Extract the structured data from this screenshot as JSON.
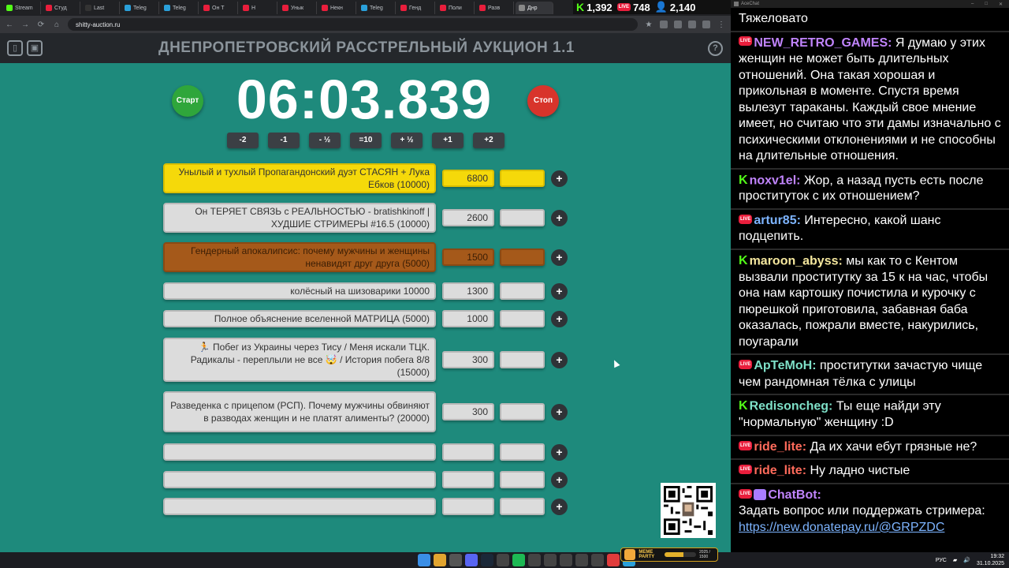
{
  "browser": {
    "tabs": [
      {
        "label": "Stream",
        "color": "#53fc18"
      },
      {
        "label": "Студ",
        "color": "#e91e3c"
      },
      {
        "label": "Last",
        "color": "#333"
      },
      {
        "label": "Teleg",
        "color": "#2aa0da"
      },
      {
        "label": "Teleg",
        "color": "#2aa0da"
      },
      {
        "label": "Он Т",
        "color": "#e91e3c"
      },
      {
        "label": "Н",
        "color": "#e91e3c"
      },
      {
        "label": "Унык",
        "color": "#e91e3c"
      },
      {
        "label": "Некн",
        "color": "#e91e3c"
      },
      {
        "label": "Teleg",
        "color": "#2aa0da"
      },
      {
        "label": "Генд",
        "color": "#e91e3c"
      },
      {
        "label": "Поли",
        "color": "#e91e3c"
      },
      {
        "label": "Разв",
        "color": "#e91e3c"
      },
      {
        "label": "Днр",
        "color": "#888"
      }
    ],
    "url": "shitty-auction.ru"
  },
  "stats": {
    "kick_count": "1,392",
    "live_count": "748",
    "viewers": "2,140"
  },
  "page": {
    "title": "ДНЕПРОПЕТРОВСКИЙ РАССТРЕЛЬНЫЙ АУКЦИОН 1.1",
    "start_label": "Старт",
    "stop_label": "Стоп",
    "timer": "06:03.839",
    "help_icon": "?",
    "adjust_buttons": [
      "-2",
      "-1",
      "- ½",
      "=10",
      "+ ½",
      "+1",
      "+2"
    ]
  },
  "lots": [
    {
      "name": "Унылый и тухлый Пропагандонский дуэт СТАСЯН + Лука Ебков (10000)",
      "amount": "6800",
      "style": "gold"
    },
    {
      "name": "Он ТЕРЯЕТ СВЯЗЬ с РЕАЛЬНОСТЬЮ - bratishkinoff | ХУДШИЕ СТРИМЕРЫ #16.5 (10000)",
      "amount": "2600",
      "style": "silver"
    },
    {
      "name": "Гендерный апокалипсис: почему мужчины и женщины ненавидят друг друга (5000)",
      "amount": "1500",
      "style": "brown"
    },
    {
      "name": "колёсный на шизоварики 10000",
      "amount": "1300",
      "style": "plain"
    },
    {
      "name": "Полное объяснение вселенной МАТРИЦА (5000)",
      "amount": "1000",
      "style": "plain"
    },
    {
      "name": "🏃 Побег из Украины через Тису / Меня искали ТЦК. Радикалы - переплыли не все 🤯 / История побега 8/8 (15000)",
      "amount": "300",
      "style": "plain"
    },
    {
      "name": "Разведенка с прицепом (РСП). Почему мужчины обвиняют в разводах женщин и не платят алименты? (20000)",
      "amount": "300",
      "style": "plain"
    },
    {
      "name": "",
      "amount": "",
      "style": "plain"
    },
    {
      "name": "",
      "amount": "",
      "style": "plain"
    },
    {
      "name": "",
      "amount": "",
      "style": "plain"
    }
  ],
  "chat": {
    "window_title": "AceChat",
    "messages": [
      {
        "platform": "none",
        "user": "",
        "user_color": "#ffffff",
        "text": "Тяжеловато"
      },
      {
        "platform": "live",
        "user": "NEW_RETRO_GAMES:",
        "user_color": "#c084fc",
        "text": "Я думаю у этих женщин не может быть длительных отношений. Она такая хорошая и прикольная в моменте. Спустя время вылезут тараканы. Каждый свое мнение имеет, но считаю что эти дамы изначально с психическими отклонениями и не способны на длительные отношения."
      },
      {
        "platform": "kick",
        "user": "noxv1el:",
        "user_color": "#c084fc",
        "text": "Жор, а назад пусть есть после проституток с их отношением?"
      },
      {
        "platform": "live",
        "user": "artur85:",
        "user_color": "#7db4ff",
        "text": "Интересно, какой шанс подцепить."
      },
      {
        "platform": "kick",
        "user": "maroon_abyss:",
        "user_color": "#f5e79e",
        "text": "мы как то с Кентом вызвали проститутку за 15 к на час, чтобы она нам картошку почистила и курочку с пюрешкой приготовила, забавная баба оказалась, пожрали вместе, накурились, поугарали"
      },
      {
        "platform": "live",
        "user": "АрТеМоН:",
        "user_color": "#7ee0c8",
        "text": "проститутки зачастую чище чем рандомная тёлка с улицы"
      },
      {
        "platform": "kick",
        "user": "Redisoncheg:",
        "user_color": "#7ee0c8",
        "text": "Ты еще найди эту \"нормальную\" женщину :D"
      },
      {
        "platform": "live",
        "user": "ride_lite:",
        "user_color": "#ff6b5b",
        "text": "Да их хачи ебут грязные не?"
      },
      {
        "platform": "live",
        "user": "ride_lite:",
        "user_color": "#ff6b5b",
        "text": "Ну ладно чистые"
      }
    ],
    "bot": {
      "user": "ChatBot:",
      "user_color": "#c084fc",
      "text": "Задать вопрос или поддержать стримера:",
      "link": "https://new.donatepay.ru/@GRPZDC"
    }
  },
  "taskbar": {
    "lang": "РУС",
    "time": "19:32",
    "date": "31.10.2025",
    "meme_label": "MEME PARTY",
    "meme_count": "2025 / 1500",
    "meme_progress": 0.6
  }
}
